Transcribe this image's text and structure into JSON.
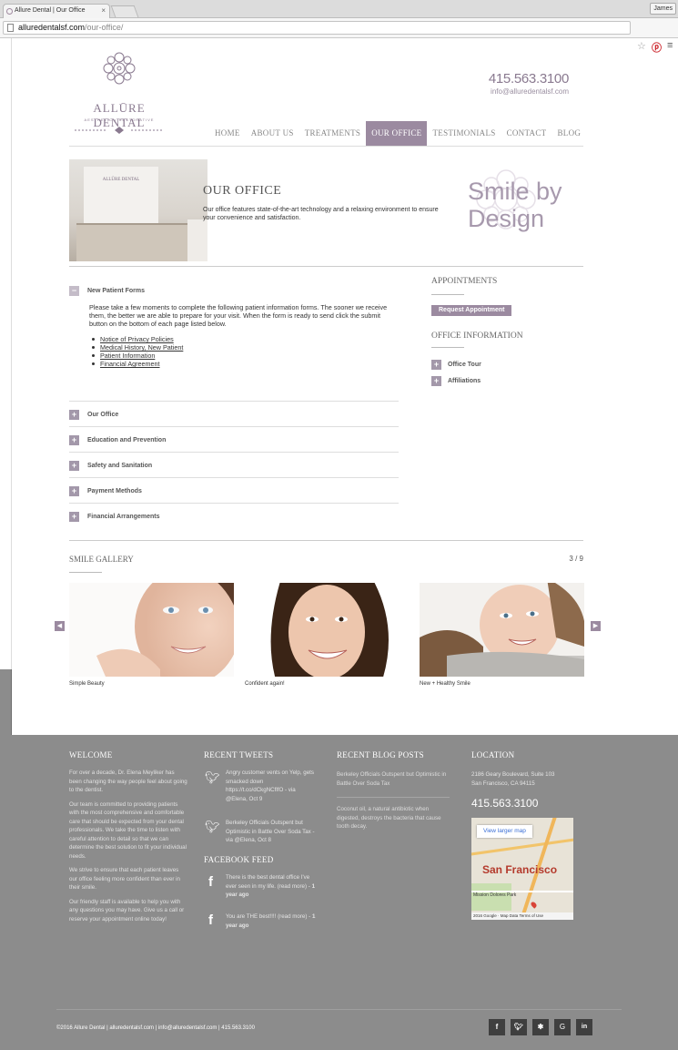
{
  "browser": {
    "tab_title": "Allure Dental | Our Office",
    "profile": "James",
    "url_domain": "alluredentalsf.com",
    "url_path": "/our-office/"
  },
  "header": {
    "logo_name": "ALLŪRE DENTAL",
    "logo_tagline": "AESTHETIC • RESTORATIVE",
    "phone": "415.563.3100",
    "email": "info@alluredentalsf.com",
    "nav": [
      "HOME",
      "ABOUT US",
      "TREATMENTS",
      "OUR OFFICE",
      "TESTIMONIALS",
      "CONTACT",
      "BLOG"
    ],
    "active_nav": "OUR OFFICE"
  },
  "banner": {
    "photo_sign": "ALLŪRE DENTAL",
    "title": "OUR OFFICE",
    "desc": "Our office features state-of-the-art technology and a relaxing environment to ensure your convenience and satisfaction.",
    "smile_line1": "Smile by",
    "smile_line2": "Design"
  },
  "accordion": {
    "open": {
      "label": "New Patient Forms",
      "text": "Please take a few moments to complete the following patient information forms. The sooner we receive them, the better we are able to prepare for your visit. When the form is ready to send click the submit button on the bottom of each page listed below.",
      "links": [
        "Notice of Privacy Policies",
        "Medical History, New Patient",
        "Patient Information",
        "Financial Agreement"
      ]
    },
    "items": [
      "Our Office",
      "Education and Prevention",
      "Safety and Sanitation",
      "Payment Methods",
      "Financial Arrangements"
    ]
  },
  "sidebar": {
    "appointments_title": "APPOINTMENTS",
    "request_button": "Request Appointment",
    "office_info_title": "OFFICE INFORMATION",
    "items": [
      "Office Tour",
      "Affiliations"
    ]
  },
  "gallery": {
    "title": "SMILE GALLERY",
    "count": "3 / 9",
    "captions": [
      "Simple Beauty",
      "Confident again!",
      "New + Healthy Smile"
    ]
  },
  "footer": {
    "welcome_title": "WELCOME",
    "welcome_paras": [
      "For over a decade, Dr. Elena Meyliker has been changing the way people feel about going to the dentist.",
      "Our team is committed to providing patients with the most comprehensive and comfortable care that should be expected from your dental professionals. We take the time to listen with careful attention to detail so that we can determine the best solution to fit your individual needs.",
      "We strive to ensure that each patient leaves our office feeling more confident than ever in their smile.",
      "Our friendly staff is available to help you with any questions you may have. Give us a call or reserve your appointment online today!"
    ],
    "tweets_title": "RECENT TWEETS",
    "tweets": [
      "Angry customer vents on Yelp, gets smacked down https://t.co/dCkgNCflfO - via @Elena, Oct 9",
      "Berkeley Officials Outspent but Optimistic in Battle Over Soda Tax - via @Elena, Oct 8"
    ],
    "fb_title": "FACEBOOK FEED",
    "fb_posts": [
      {
        "text": "There is the best dental office I've ever seen in my life. (read more) -",
        "time": "1 year ago"
      },
      {
        "text": "You are THE best!!!! (read more) -",
        "time": "1 year ago"
      }
    ],
    "blog_title": "RECENT BLOG POSTS",
    "blog_posts": [
      "Berkeley Officials Outspent but Optimistic in Battle Over Soda Tax",
      "Coconut oil, a natural antibiotic when digested, destroys the bacteria that cause tooth decay."
    ],
    "location_title": "LOCATION",
    "address1": "2186 Geary Boulevard, Suite 103",
    "address2": "San Francisco, CA 94115",
    "phone": "415.563.3100",
    "map": {
      "button": "View larger map",
      "city": "San Francisco",
      "mission": "Mission Dolores Park",
      "attribution": "2016 Google · Map Data   Terms of Use"
    },
    "copyright": "©2016 Allure Dental  |  alluredentalsf.com  |  info@alluredentalsf.com  |  415.563.3100",
    "social": [
      "f",
      "t",
      "y",
      "G",
      "in"
    ]
  }
}
